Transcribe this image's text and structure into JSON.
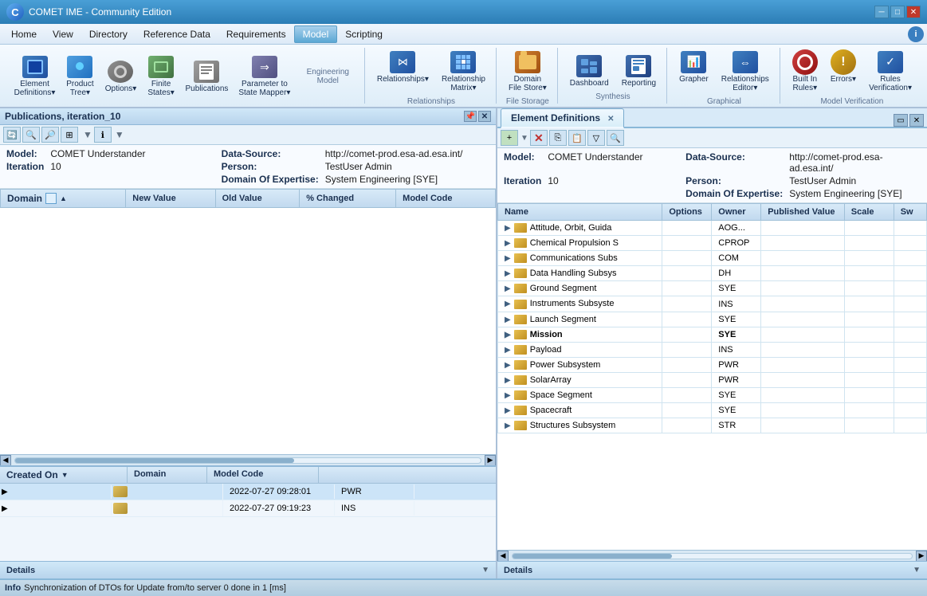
{
  "app": {
    "title": "COMET IME - Community Edition"
  },
  "titlebar": {
    "minimize_label": "─",
    "restore_label": "□",
    "close_label": "✕"
  },
  "menu": {
    "items": [
      "Home",
      "View",
      "Directory",
      "Reference Data",
      "Requirements",
      "Model",
      "Scripting"
    ],
    "active_index": 5
  },
  "toolbar": {
    "groups": [
      {
        "label": "Engineering Model",
        "buttons": [
          {
            "id": "element-definitions",
            "label": "Element\nDefinitions▾",
            "color": "blue"
          },
          {
            "id": "product-tree",
            "label": "Product\nTree▾",
            "color": "blue"
          },
          {
            "id": "options",
            "label": "Options▾",
            "color": "gray"
          },
          {
            "id": "finite-states",
            "label": "Finite\nStates▾",
            "color": "gray"
          },
          {
            "id": "publications",
            "label": "Publications",
            "color": "gray"
          },
          {
            "id": "parameter-to-state",
            "label": "Parameter to\nState Mapper▾",
            "color": "gray"
          }
        ]
      },
      {
        "label": "Relationships",
        "buttons": [
          {
            "id": "relationships",
            "label": "Relationships▾",
            "color": "blue"
          },
          {
            "id": "relationship-matrix",
            "label": "Relationship\nMatrix▾",
            "color": "blue"
          }
        ]
      },
      {
        "label": "File Storage",
        "buttons": [
          {
            "id": "domain-file-store",
            "label": "Domain\nFile Store▾",
            "color": "orange"
          }
        ]
      },
      {
        "label": "Synthesis",
        "buttons": [
          {
            "id": "dashboard",
            "label": "Dashboard",
            "color": "blue"
          },
          {
            "id": "reporting",
            "label": "Reporting",
            "color": "blue"
          }
        ]
      },
      {
        "label": "Graphical",
        "buttons": [
          {
            "id": "grapher",
            "label": "Grapher",
            "color": "blue"
          },
          {
            "id": "relationships-editor",
            "label": "Relationships\nEditor▾",
            "color": "blue"
          }
        ]
      },
      {
        "label": "Model Verification",
        "buttons": [
          {
            "id": "built-in-rules",
            "label": "Built In\nRules▾",
            "color": "red"
          },
          {
            "id": "errors",
            "label": "Errors▾",
            "color": "yellow"
          },
          {
            "id": "rules-verification",
            "label": "Rules\nVerification▾",
            "color": "blue"
          }
        ]
      }
    ]
  },
  "left_panel": {
    "title": "Publications, iteration_10",
    "model_info": {
      "model_label": "Model:",
      "model_value": "COMET Understander",
      "datasource_label": "Data-Source:",
      "datasource_value": "http://comet-prod.esa-ad.esa.int/",
      "iteration_label": "Iteration",
      "iteration_value": "10",
      "person_label": "Person:",
      "person_value": "TestUser Admin",
      "doe_label": "Domain Of Expertise:",
      "doe_value": "System Engineering [SYE]"
    },
    "table": {
      "columns": [
        "Domain",
        "New Value",
        "Old Value",
        "% Changed",
        "Model Code"
      ],
      "rows": []
    },
    "list": {
      "columns": [
        "Created On",
        "Domain",
        "Model Code"
      ],
      "rows": [
        {
          "created_on": "2022-07-27 09:28:01",
          "domain": "PWR",
          "model_code": ""
        },
        {
          "created_on": "2022-07-27 09:19:23",
          "domain": "INS",
          "model_code": ""
        }
      ]
    },
    "details_label": "Details"
  },
  "right_panel": {
    "tab_label": "Element Definitions",
    "model_info": {
      "model_label": "Model:",
      "model_value": "COMET Understander",
      "datasource_label": "Data-Source:",
      "datasource_value": "http://comet-prod.esa-ad.esa.int/",
      "iteration_label": "Iteration",
      "iteration_value": "10",
      "person_label": "Person:",
      "person_value": "TestUser Admin",
      "doe_label": "Domain Of Expertise:",
      "doe_value": "System Engineering [SYE]"
    },
    "table": {
      "columns": [
        "Name",
        "Options",
        "Owner",
        "Published Value",
        "Scale",
        "Sw"
      ],
      "rows": [
        {
          "name": "Attitude, Orbit, Guida",
          "options": "",
          "owner": "AOG...",
          "published_value": "",
          "scale": "",
          "bold": false
        },
        {
          "name": "Chemical Propulsion S",
          "options": "",
          "owner": "CPROP",
          "published_value": "",
          "scale": "",
          "bold": false
        },
        {
          "name": "Communications Subs",
          "options": "",
          "owner": "COM",
          "published_value": "",
          "scale": "",
          "bold": false
        },
        {
          "name": "Data Handling Subsys",
          "options": "",
          "owner": "DH",
          "published_value": "",
          "scale": "",
          "bold": false
        },
        {
          "name": "Ground Segment",
          "options": "",
          "owner": "SYE",
          "published_value": "",
          "scale": "",
          "bold": false
        },
        {
          "name": "Instruments Subsyste",
          "options": "",
          "owner": "INS",
          "published_value": "",
          "scale": "",
          "bold": false
        },
        {
          "name": "Launch Segment",
          "options": "",
          "owner": "SYE",
          "published_value": "",
          "scale": "",
          "bold": false
        },
        {
          "name": "Mission",
          "options": "",
          "owner": "SYE",
          "published_value": "",
          "scale": "",
          "bold": true
        },
        {
          "name": "Payload",
          "options": "",
          "owner": "INS",
          "published_value": "",
          "scale": "",
          "bold": false
        },
        {
          "name": "Power Subsystem",
          "options": "",
          "owner": "PWR",
          "published_value": "",
          "scale": "",
          "bold": false
        },
        {
          "name": "SolarArray",
          "options": "",
          "owner": "PWR",
          "published_value": "",
          "scale": "",
          "bold": false
        },
        {
          "name": "Space Segment",
          "options": "",
          "owner": "SYE",
          "published_value": "",
          "scale": "",
          "bold": false
        },
        {
          "name": "Spacecraft",
          "options": "",
          "owner": "SYE",
          "published_value": "",
          "scale": "",
          "bold": false
        },
        {
          "name": "Structures Subsystem",
          "options": "",
          "owner": "STR",
          "published_value": "",
          "scale": "",
          "bold": false
        }
      ]
    },
    "details_label": "Details"
  },
  "status_bar": {
    "label": "Info",
    "message": "Synchronization of DTOs for Update from/to server 0 done in 1 [ms]"
  },
  "icons": {
    "minimize": "─",
    "restore": "❐",
    "close": "✕",
    "expand": "▶",
    "collapse": "▼",
    "sort_asc": "▲",
    "check": "☑",
    "plus": "+",
    "minus": "─",
    "search": "🔍",
    "filter": "▼",
    "left_arrow": "◀",
    "right_arrow": "▶"
  }
}
